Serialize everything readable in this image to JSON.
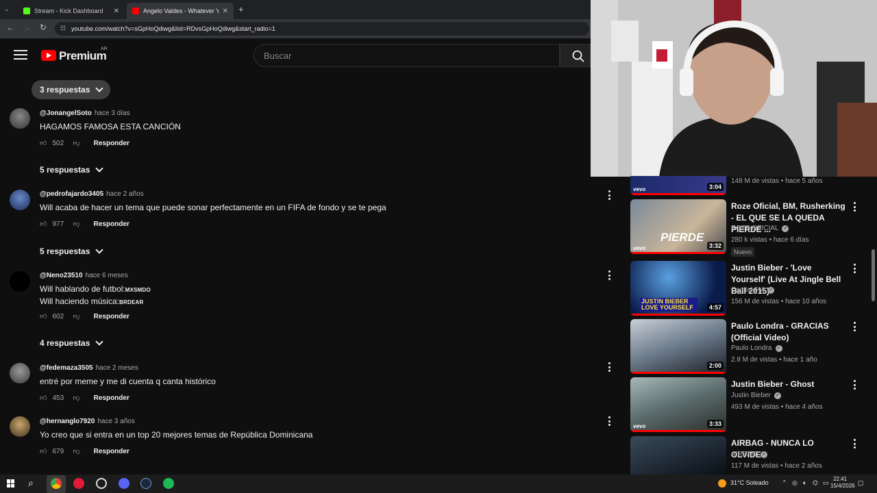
{
  "browser": {
    "tabs": [
      {
        "title": "Stream - Kick Dashboard",
        "color": "#53fc18"
      },
      {
        "title": "Angelo Valdes - Whatever You",
        "color": "#ff0000"
      }
    ],
    "new_tab": "+",
    "url": "youtube.com/watch?v=sGpHoQdiwg&list=RDvsGpHoQdiwg&start_radio=1"
  },
  "youtube": {
    "brand": "Premium",
    "country": "AR",
    "search_placeholder": "Buscar"
  },
  "comments": [
    {
      "replies_top": "3 respuestas"
    },
    {
      "handle": "@JonangelSoto",
      "time": "hace 3 días",
      "text": "HAGAMOS FAMOSA ESTA CANCIÓN",
      "likes": "502",
      "reply_label": "Responder",
      "replies": "5 respuestas"
    },
    {
      "handle": "@pedrofajardo3405",
      "time": "hace 2 años",
      "text": "Will acaba de hacer un tema que puede sonar perfectamente en un FIFA de fondo y se te pega",
      "likes": "977",
      "reply_label": "Responder",
      "replies": "5 respuestas"
    },
    {
      "handle": "@Neno23510",
      "time": "hace 6 meses",
      "line1": "Will hablando de futbol:",
      "line1_tag": "MXSMDO",
      "line2": "Will haciendo música:",
      "line2_tag": "BRDEAR",
      "likes": "602",
      "reply_label": "Responder",
      "replies": "4 respuestas"
    },
    {
      "handle": "@fedemaza3505",
      "time": "hace 2 meses",
      "text": "entré por meme y me di cuenta q canta histórico",
      "likes": "453",
      "reply_label": "Responder"
    },
    {
      "handle": "@hernanglo7920",
      "time": "hace 3 años",
      "text": "Yo creo que si entra en un top 20 mejores temas de República Dominicana",
      "likes": "679",
      "reply_label": "Responder"
    }
  ],
  "related": [
    {
      "meta": "148 M de vistas • hace 5 años",
      "duration": "3:04"
    },
    {
      "title": "Roze Oficial, BM, Rusherking - EL QUE SE LA QUEDA PIERDE ...",
      "channel": "ROZE OFICIAL",
      "meta": "280 k vistas • hace 6 días",
      "badge": "Nuevo",
      "duration": "3:32",
      "thumb_text": "PIERDE"
    },
    {
      "title": "Justin Bieber - 'Love Yourself' (Live At Jingle Bell Ball 2015)",
      "channel": "Capital FM",
      "meta": "156 M de vistas • hace 10 años",
      "duration": "4:57",
      "thumb_text": "JUSTIN BIEBER LOVE YOURSELF"
    },
    {
      "title": "Paulo Londra - GRACIAS (Official Video)",
      "channel": "Paulo Londra",
      "meta": "2.8 M de vistas • hace 1 año",
      "duration": "2:00"
    },
    {
      "title": "Justin Bieber - Ghost",
      "channel": "Justin Bieber",
      "meta": "493 M de vistas • hace 4 años",
      "duration": "3:33"
    },
    {
      "title": "AIRBAG - NUNCA LO OLVIDES",
      "channel": "AIRBAG",
      "meta": "117 M de vistas • hace 2 años"
    }
  ],
  "thumb_vevo": "vevo",
  "taskbar": {
    "weather": "31°C  Soleado",
    "time": "22:41",
    "date": "15/4/2026"
  }
}
